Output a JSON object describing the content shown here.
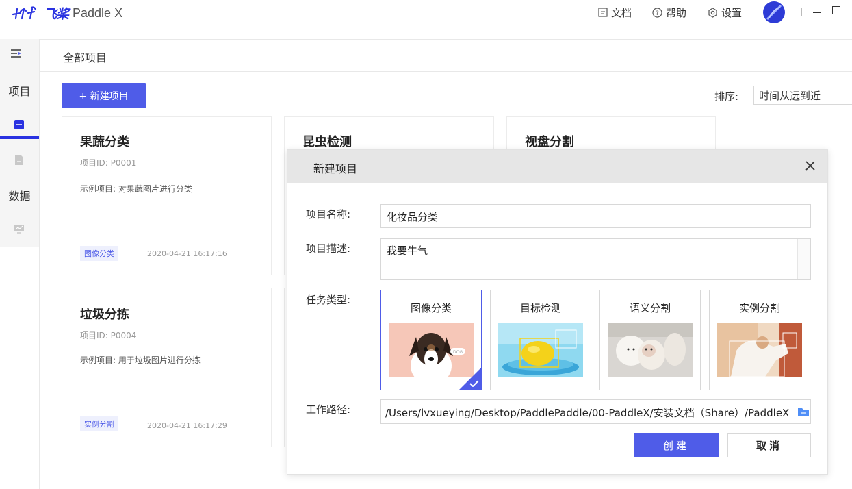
{
  "app": {
    "logo_cn": "飞桨",
    "logo_en": "Paddle X"
  },
  "topbar": {
    "docs": "文档",
    "help": "帮助",
    "settings": "设置"
  },
  "sidebar": {
    "projects_label": "项目",
    "data_label": "数据"
  },
  "page": {
    "title": "全部项目"
  },
  "toolbar": {
    "new_project": "+ 新建项目",
    "sort_label": "排序:",
    "sort_value": "时间从远到近"
  },
  "cards": [
    {
      "title": "果蔬分类",
      "id": "项目ID: P0001",
      "desc": "示例项目: 对果蔬图片进行分类",
      "tag": "图像分类",
      "date": "2020-04-21 16:17:16"
    },
    {
      "title": "昆虫检测"
    },
    {
      "title": "视盘分割"
    },
    {
      "title": "垃圾分拣",
      "id": "项目ID: P0004",
      "desc": "示例项目: 用于垃圾图片进行分拣",
      "tag": "实例分割",
      "date": "2020-04-21 16:17:29"
    }
  ],
  "modal": {
    "title": "新建项目",
    "name_label": "项目名称:",
    "name_value": "化妆品分类",
    "desc_label": "项目描述:",
    "desc_value": "我要牛气",
    "task_label": "任务类型:",
    "tasks": [
      {
        "label": "图像分类",
        "selected": true
      },
      {
        "label": "目标检测",
        "selected": false
      },
      {
        "label": "语义分割",
        "selected": false
      },
      {
        "label": "实例分割",
        "selected": false
      }
    ],
    "path_label": "工作路径:",
    "path_value": "/Users/lvxueying/Desktop/PaddlePaddle/00-PaddleX/安装文档（Share）/PaddleX",
    "create": "创建",
    "cancel": "取消"
  },
  "colors": {
    "accent": "#4f5ce8",
    "brand": "#2932e1"
  }
}
